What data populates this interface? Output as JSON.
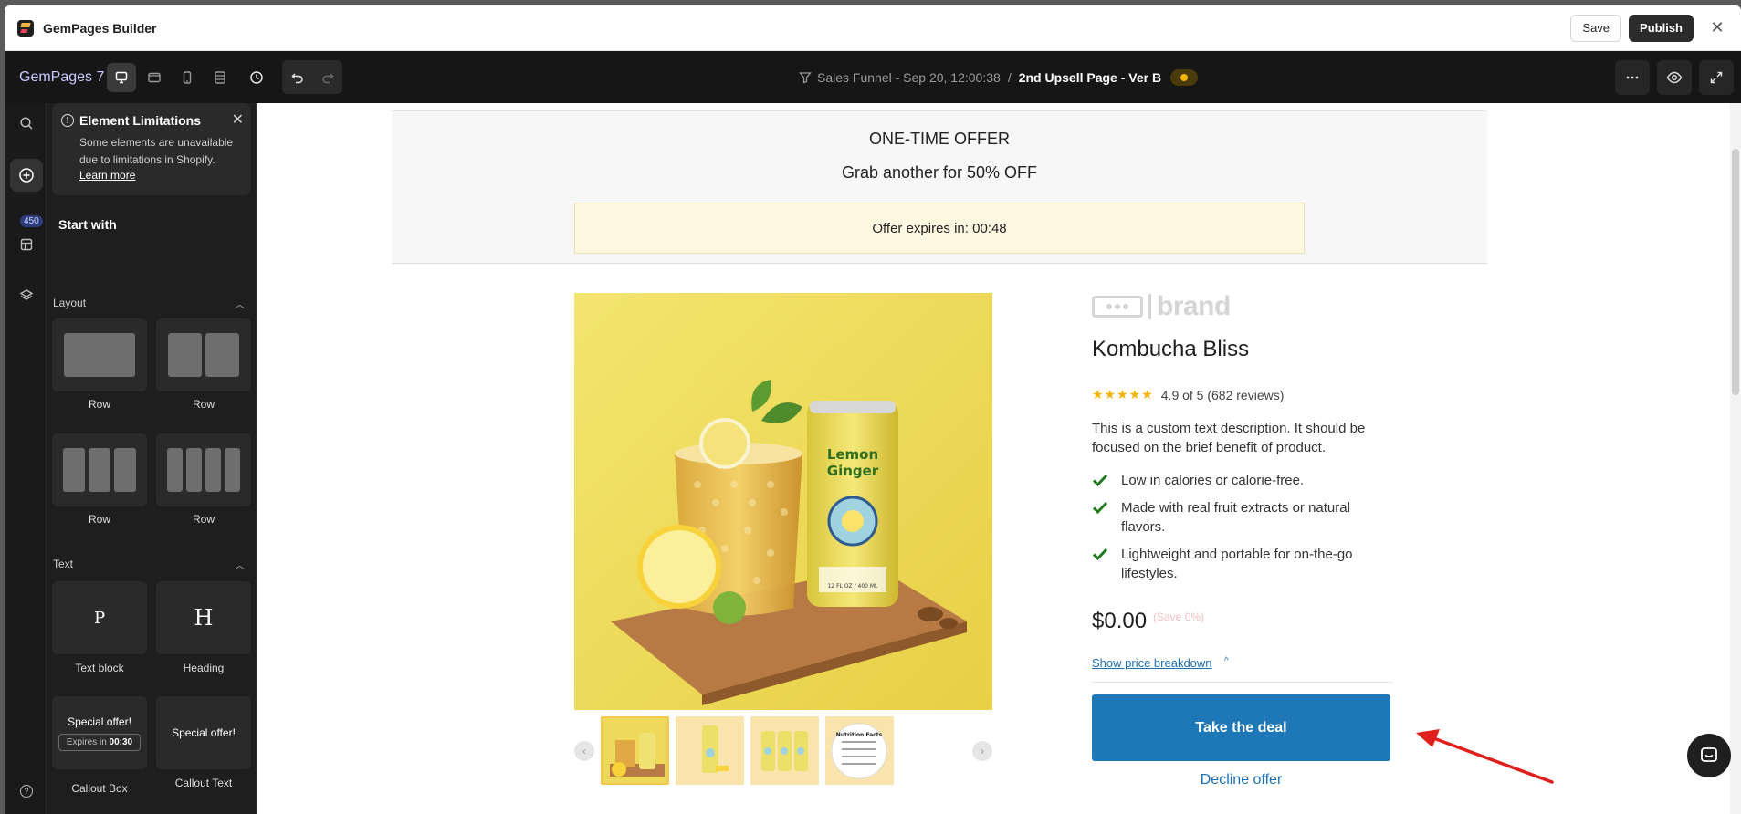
{
  "titlebar": {
    "app_title": "GemPages Builder",
    "save_label": "Save",
    "publish_label": "Publish",
    "close_glyph": "✕"
  },
  "toolbar": {
    "brand": "GemPages 7",
    "funnel_name": "Sales Funnel - Sep 20, 12:00:38",
    "separator": "/",
    "page_name": "2nd Upsell Page - Ver B",
    "status_color": "#f5b400",
    "device_icons": [
      "desktop-icon",
      "tablet-landscape-icon",
      "mobile-icon",
      "responsive-icon"
    ],
    "right_icons": [
      "more-icon",
      "preview-eye-icon",
      "fullscreen-icon"
    ]
  },
  "rail": {
    "badge": "450",
    "items": [
      "search-icon",
      "add-element-icon",
      "template-icon",
      "layers-icon",
      "help-icon"
    ]
  },
  "panel": {
    "notice": {
      "title": "Element Limitations",
      "text": "Some elements are unavailable due to limitations in Shopify.",
      "link": "Learn more"
    },
    "start_with": "Start with",
    "layout_section": "Layout",
    "layout_items": [
      "Row",
      "Row",
      "Row",
      "Row"
    ],
    "text_section": "Text",
    "text_items": {
      "text_block": "Text block",
      "heading": "Heading",
      "callout_box": "Callout Box",
      "callout_text": "Callout Text"
    },
    "glyphs": {
      "p": "P",
      "h": "H"
    },
    "callout_preview": {
      "title": "Special offer!",
      "expires_label": "Expires in",
      "expires_time": "00:30",
      "text_title": "Special offer!"
    }
  },
  "canvas": {
    "offer_title": "ONE-TIME OFFER",
    "offer_subtitle": "Grab another for 50% OFF",
    "timer": "Offer expires in: 00:48",
    "brand_logo_word": "brand",
    "product_title": "Kombucha Bliss",
    "rating": {
      "stars": 5,
      "text": "4.9 of 5 (682 reviews)"
    },
    "description": "This is a custom text description. It should be focused on the brief benefit of product.",
    "bullets": [
      "Low in calories or calorie-free.",
      "Made with real fruit extracts or natural flavors.",
      "Lightweight and portable for on-the-go lifestyles."
    ],
    "price": "$0.00",
    "save": "(Save 0%)",
    "breakdown_link": "Show price breakdown",
    "cta": "Take the deal",
    "decline": "Decline offer",
    "can_text": {
      "line1": "Lemon",
      "line2": "Ginger",
      "volume": "12 FL OZ / 400 ML"
    },
    "nutrition_label": "Nutrition Facts",
    "accent_color": "#1e78b8",
    "annotation_arrow_color": "#e0201c"
  }
}
